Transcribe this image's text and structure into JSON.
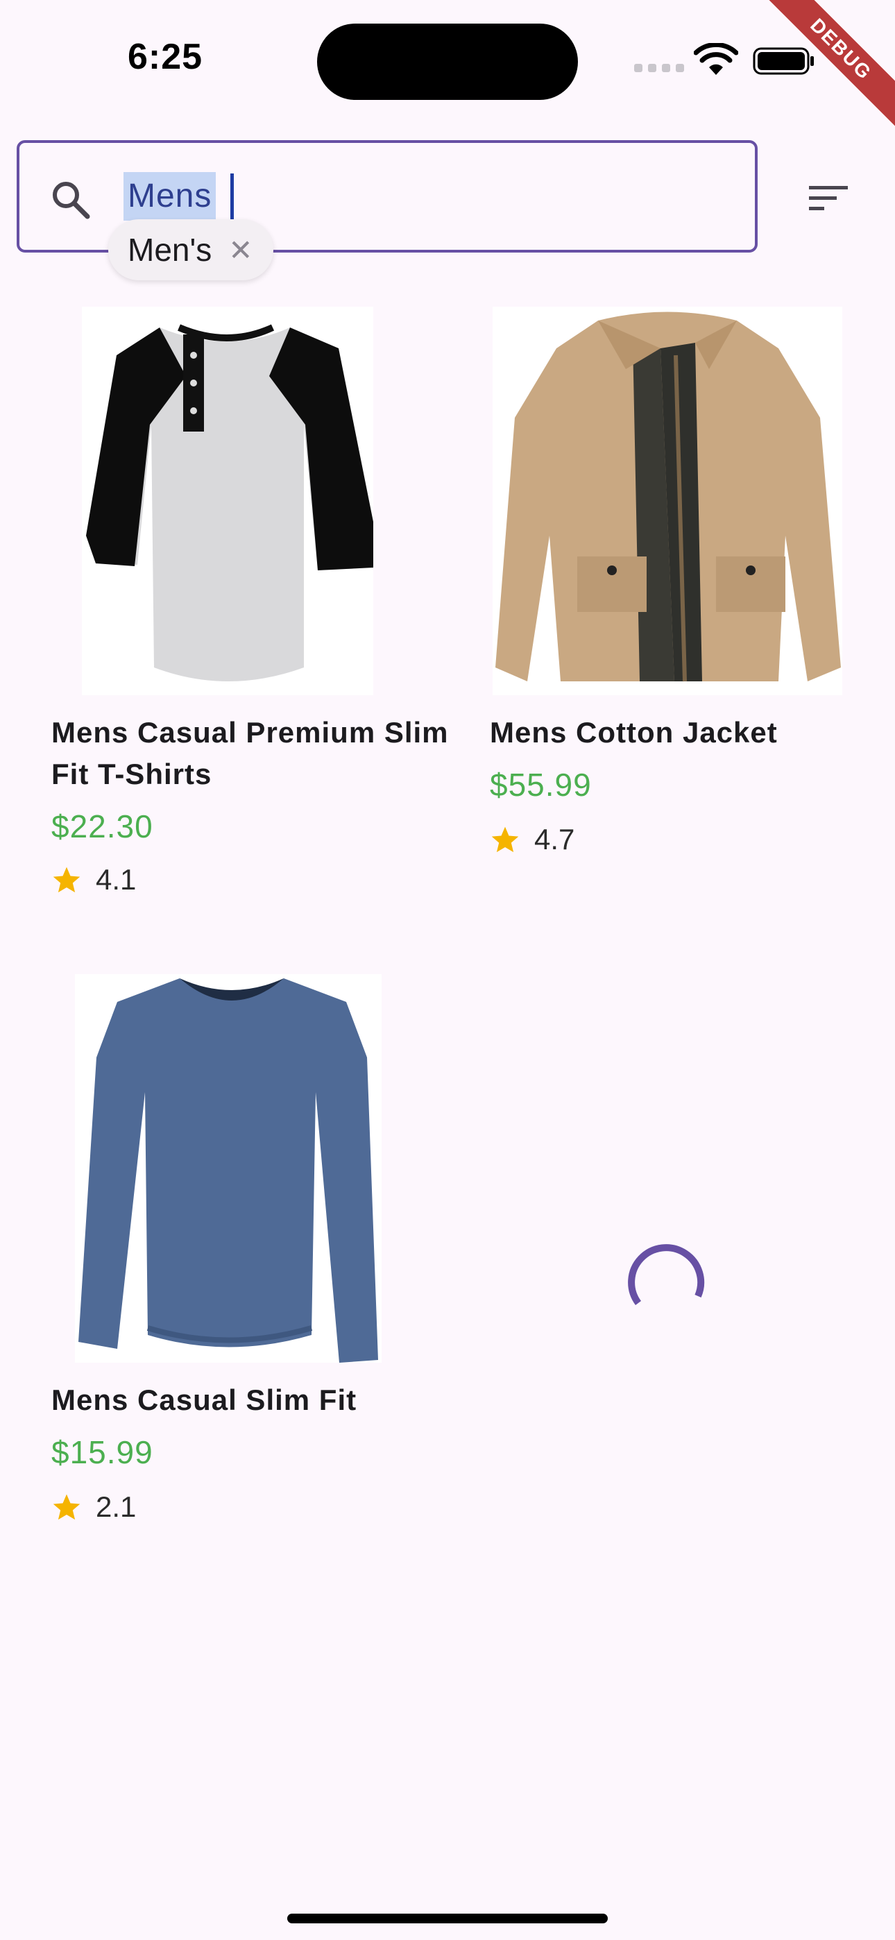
{
  "status_bar": {
    "time": "6:25",
    "debug_label": "DEBUG"
  },
  "search": {
    "query": "Mens",
    "suggestion": "Men's",
    "suggestion_close": "✕"
  },
  "products": [
    {
      "title": "Mens Casual Premium Slim Fit T-Shirts",
      "price": "$22.30",
      "rating": "4.1",
      "image": "raglan-henley-tshirt"
    },
    {
      "title": "Mens Cotton Jacket",
      "price": "$55.99",
      "rating": "4.7",
      "image": "khaki-cotton-jacket"
    },
    {
      "title": "Mens Casual Slim Fit",
      "price": "$15.99",
      "rating": "2.1",
      "image": "blue-long-sleeve-vneck"
    }
  ],
  "colors": {
    "accent": "#6750a4",
    "price": "#4caf50",
    "star": "#f5b400",
    "background": "#fdf7fd"
  }
}
